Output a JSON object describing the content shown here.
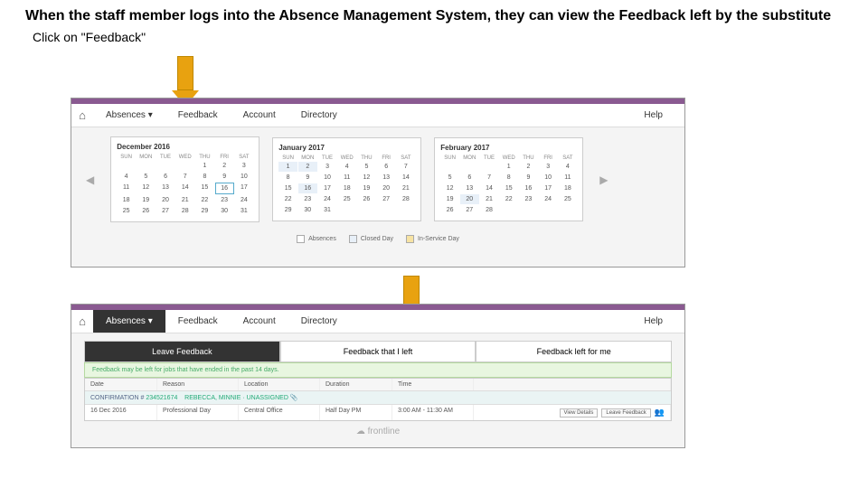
{
  "heading": "When the staff member logs into the Absence Management System, they can view the Feedback left by the substitute",
  "subheading": "Click on \"Feedback\"",
  "nav": {
    "home_icon": "⌂",
    "items": [
      "Absences ▾",
      "Feedback",
      "Account",
      "Directory"
    ],
    "help": "Help"
  },
  "calendars": [
    {
      "title": "December 2016",
      "headers": [
        "SUN",
        "MON",
        "TUE",
        "WED",
        "THU",
        "FRI",
        "SAT"
      ],
      "rows": [
        [
          "",
          "",
          "",
          "",
          "1",
          "2",
          "3"
        ],
        [
          "4",
          "5",
          "6",
          "7",
          "8",
          "9",
          "10"
        ],
        [
          "11",
          "12",
          "13",
          "14",
          "15",
          "16",
          "17"
        ],
        [
          "18",
          "19",
          "20",
          "21",
          "22",
          "23",
          "24"
        ],
        [
          "25",
          "26",
          "27",
          "28",
          "29",
          "30",
          "31"
        ]
      ]
    },
    {
      "title": "January 2017",
      "headers": [
        "SUN",
        "MON",
        "TUE",
        "WED",
        "THU",
        "FRI",
        "SAT"
      ],
      "rows": [
        [
          "1",
          "2",
          "3",
          "4",
          "5",
          "6",
          "7"
        ],
        [
          "8",
          "9",
          "10",
          "11",
          "12",
          "13",
          "14"
        ],
        [
          "15",
          "16",
          "17",
          "18",
          "19",
          "20",
          "21"
        ],
        [
          "22",
          "23",
          "24",
          "25",
          "26",
          "27",
          "28"
        ],
        [
          "29",
          "30",
          "31",
          "",
          "",
          "",
          ""
        ]
      ]
    },
    {
      "title": "February 2017",
      "headers": [
        "SUN",
        "MON",
        "TUE",
        "WED",
        "THU",
        "FRI",
        "SAT"
      ],
      "rows": [
        [
          "",
          "",
          "",
          "1",
          "2",
          "3",
          "4"
        ],
        [
          "5",
          "6",
          "7",
          "8",
          "9",
          "10",
          "11"
        ],
        [
          "12",
          "13",
          "14",
          "15",
          "16",
          "17",
          "18"
        ],
        [
          "19",
          "20",
          "21",
          "22",
          "23",
          "24",
          "25"
        ],
        [
          "26",
          "27",
          "28",
          "",
          "",
          "",
          ""
        ]
      ]
    }
  ],
  "legend": [
    {
      "label": "Absences",
      "color": "#ffffff"
    },
    {
      "label": "Closed Day",
      "color": "#e8f0f8"
    },
    {
      "label": "In-Service Day",
      "color": "#f7e3a3"
    }
  ],
  "feedback_tabs": [
    "Leave Feedback",
    "Feedback that I left",
    "Feedback left for me"
  ],
  "info_strip": "Feedback may be left for jobs that have ended in the past 14 days.",
  "table": {
    "headers": [
      "Date",
      "Reason",
      "Location",
      "Duration",
      "Time"
    ],
    "confirmation_label": "CONFIRMATION #",
    "confirmation_number": "234521674",
    "confirmation_name": "REBECCA, MINNIE · UNASSIGNED",
    "row": {
      "date": "16 Dec 2016",
      "reason": "Professional Day",
      "location": "Central Office",
      "duration": "Half Day PM",
      "time": "3:00 AM - 11:30 AM"
    },
    "actions": [
      "View Details",
      "Leave Feedback"
    ]
  },
  "footer_logo": "frontline"
}
